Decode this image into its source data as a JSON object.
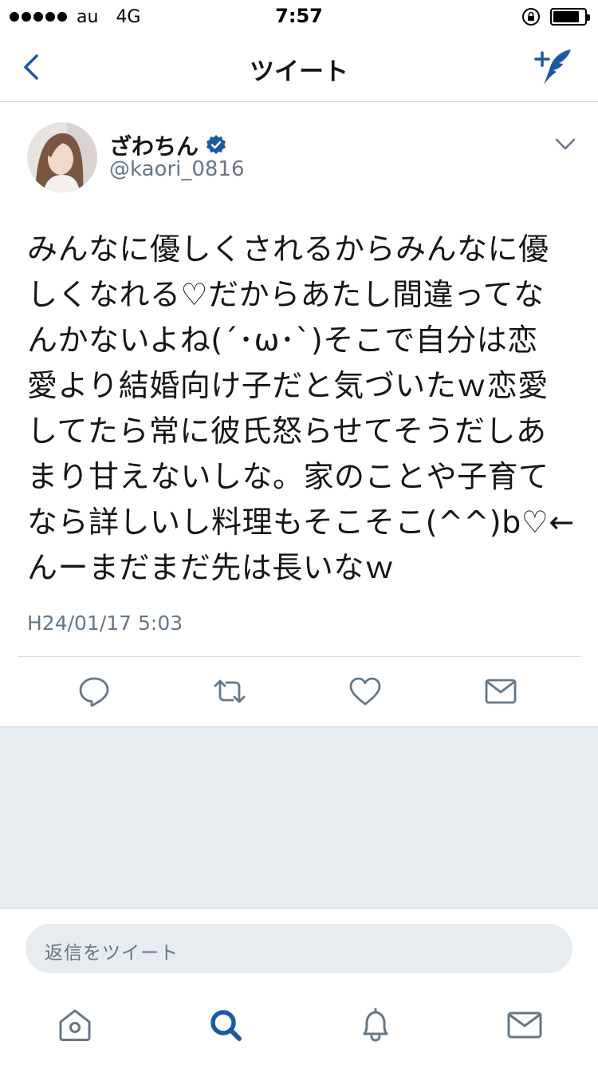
{
  "status_bar": {
    "carrier": "au",
    "network": "4G",
    "time": "7:57",
    "battery_level": 0.85
  },
  "nav": {
    "title": "ツイート",
    "back_icon": "chevron-left-icon",
    "compose_icon": "compose-tweet-icon"
  },
  "tweet": {
    "user": {
      "name": "ざわちん",
      "handle": "@kaori_0816",
      "verified": true
    },
    "text_lines": [
      "みんなに優しくされるからみんなに優",
      "しくなれる♡だからあたし間違ってな",
      "んかないよね(´･ω･`)そこで自分は恋",
      "愛より結婚向け子だと気づいたｗ恋愛",
      "してたら常に彼氏怒らせてそうだしあ",
      "まり甘えないしな。家のことや子育て",
      "なら詳しいし料理もそこそこ(^^)b♡←",
      "んーまだまだ先は長いなｗ"
    ],
    "timestamp": "H24/01/17 5:03"
  },
  "actions": [
    "reply-icon",
    "retweet-icon",
    "like-icon",
    "direct-message-icon"
  ],
  "reply": {
    "placeholder": "返信をツイート"
  },
  "tabs": [
    "home-icon",
    "search-icon",
    "notifications-icon",
    "messages-icon"
  ],
  "colors": {
    "accent": "#1b5aa0",
    "text": "#14171a",
    "secondary_text": "#657786",
    "divider": "#d6dbe0",
    "background_grey": "#e6ecf0"
  }
}
